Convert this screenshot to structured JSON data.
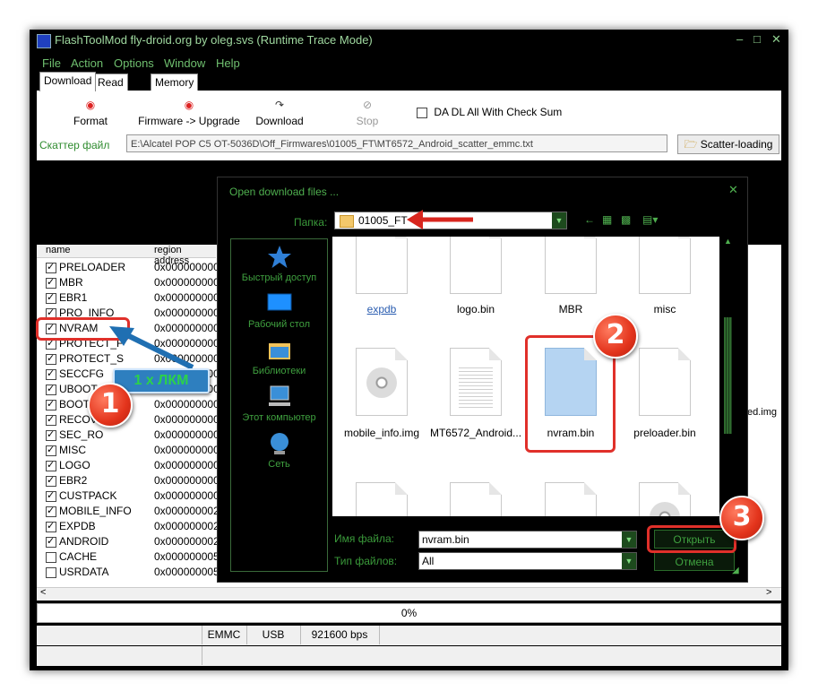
{
  "window": {
    "title": "FlashToolMod fly-droid.org by oleg.svs (Runtime Trace Mode)",
    "controls": [
      "–",
      "□",
      "✕"
    ]
  },
  "menu": [
    "File",
    "Action",
    "Options",
    "Window",
    "Help"
  ],
  "tabs": [
    "Download",
    "Read back",
    "Memory Test"
  ],
  "toolbar": {
    "format": "Format",
    "firmware_upgrade": "Firmware -> Upgrade",
    "download": "Download",
    "stop": "Stop",
    "checksum_label": "DA DL All With Check Sum"
  },
  "scatter": {
    "label": "Скаттер файл",
    "path": "E:\\Alcatel POP C5 OT-5036D\\Off_Firmwares\\01005_FT\\MT6572_Android_scatter_emmc.txt",
    "button": "Scatter-loading"
  },
  "list": {
    "col_name": "name",
    "col_region": "region address",
    "rows": [
      {
        "name": "PRELOADER",
        "addr": "0x000000000...",
        "checked": true
      },
      {
        "name": "MBR",
        "addr": "0x000000000...",
        "checked": true
      },
      {
        "name": "EBR1",
        "addr": "0x000000000...",
        "checked": true
      },
      {
        "name": "PRO_INFO",
        "addr": "0x000000000...",
        "checked": true
      },
      {
        "name": "NVRAM",
        "addr": "0x000000000...",
        "checked": true
      },
      {
        "name": "PROTECT_F",
        "addr": "0x000000000...",
        "checked": true
      },
      {
        "name": "PROTECT_S",
        "addr": "0x000000000...",
        "checked": true
      },
      {
        "name": "SECCFG",
        "addr": "0x000000000...",
        "checked": true
      },
      {
        "name": "UBOOT",
        "addr": "0x000000000...",
        "checked": true
      },
      {
        "name": "BOOTIMG",
        "addr": "0x000000000...",
        "checked": true
      },
      {
        "name": "RECOVERY",
        "addr": "0x000000000...",
        "checked": true
      },
      {
        "name": "SEC_RO",
        "addr": "0x000000000...",
        "checked": true
      },
      {
        "name": "MISC",
        "addr": "0x000000000...",
        "checked": true
      },
      {
        "name": "LOGO",
        "addr": "0x000000000...",
        "checked": true
      },
      {
        "name": "EBR2",
        "addr": "0x000000000...",
        "checked": true
      },
      {
        "name": "CUSTPACK",
        "addr": "0x000000000...",
        "checked": true
      },
      {
        "name": "MOBILE_INFO",
        "addr": "0x000000002...",
        "checked": true
      },
      {
        "name": "EXPDB",
        "addr": "0x000000002...",
        "checked": true
      },
      {
        "name": "ANDROID",
        "addr": "0x000000002...",
        "checked": true
      },
      {
        "name": "CACHE",
        "addr": "0x000000005...",
        "checked": false
      },
      {
        "name": "USRDATA",
        "addr": "0x000000005...",
        "checked": false
      }
    ],
    "partial_right_text": "ed.img"
  },
  "progress": {
    "text": "0%",
    "value": 0
  },
  "status": {
    "storage": "EMMC",
    "port": "USB",
    "baud": "921600 bps"
  },
  "dialog": {
    "title": "Open download files ...",
    "folder_label": "Папка:",
    "folder_value": "01005_FT",
    "places": [
      {
        "label": "Быстрый доступ",
        "icon": "star-icon"
      },
      {
        "label": "Рабочий стол",
        "icon": "desktop-icon"
      },
      {
        "label": "Библиотеки",
        "icon": "libraries-icon"
      },
      {
        "label": "Этот компьютер",
        "icon": "computer-icon"
      },
      {
        "label": "Сеть",
        "icon": "network-icon"
      }
    ],
    "files": [
      {
        "name": "expdb",
        "kind": "plain",
        "style": "link"
      },
      {
        "name": "logo.bin",
        "kind": "plain"
      },
      {
        "name": "MBR",
        "kind": "plain"
      },
      {
        "name": "misc",
        "kind": "plain"
      },
      {
        "name": "mobile_info.img",
        "kind": "disc"
      },
      {
        "name": "MT6572_Android...",
        "kind": "text"
      },
      {
        "name": "nvram.bin",
        "kind": "selected"
      },
      {
        "name": "preloader.bin",
        "kind": "plain"
      }
    ],
    "filename_label": "Имя файла:",
    "filename_value": "nvram.bin",
    "filetype_label": "Тип файлов:",
    "filetype_value": "All",
    "open_button": "Открыть",
    "cancel_button": "Отмена"
  },
  "annotations": {
    "step1": "1",
    "step2": "2",
    "step3": "3",
    "callout": "1 x ЛКМ"
  },
  "colors": {
    "dialog_text": "#4faf4f",
    "highlight_red": "#e0302a",
    "callout_bg": "#2e7fbf",
    "callout_text": "#2bd24a"
  }
}
